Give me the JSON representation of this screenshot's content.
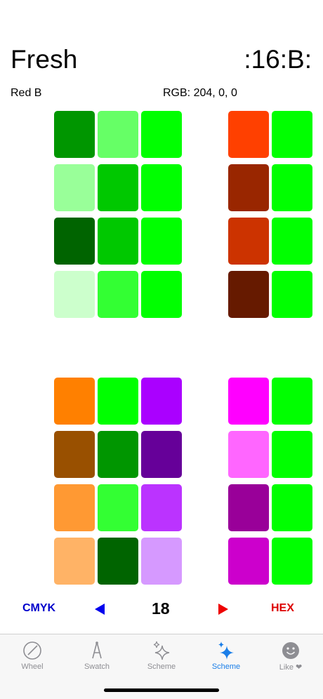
{
  "header": {
    "title": "Fresh",
    "code": ":16:B:"
  },
  "info": {
    "color_name": "Red B",
    "rgb": "RGB: 204, 0, 0"
  },
  "grids": {
    "g1": {
      "cols": 3,
      "colors": [
        "#009600",
        "#66ff66",
        "#00ff00",
        "#99ff99",
        "#00c800",
        "#00ff00",
        "#006400",
        "#00c800",
        "#00ff00",
        "#ccffcc",
        "#33ff33",
        "#00ff00"
      ]
    },
    "g2": {
      "cols": 2,
      "colors": [
        "#ff4000",
        "#00ff00",
        "#992600",
        "#00ff00",
        "#cc3300",
        "#00ff00",
        "#661a00",
        "#00ff00"
      ]
    },
    "g3": {
      "cols": 3,
      "colors": [
        "#ff8000",
        "#00ff00",
        "#aa00ff",
        "#995000",
        "#009600",
        "#660099",
        "#ff9933",
        "#33ff33",
        "#bb33ff",
        "#ffb366",
        "#006400",
        "#d699ff"
      ]
    },
    "g4": {
      "cols": 2,
      "colors": [
        "#ff00ff",
        "#00ff00",
        "#ff66ff",
        "#00ff00",
        "#990099",
        "#00ff00",
        "#cc00cc",
        "#00ff00"
      ]
    }
  },
  "controls": {
    "cmyk": "CMYK",
    "page": "18",
    "hex": "HEX",
    "prev_icon": "left-triangle-icon",
    "next_icon": "right-triangle-icon",
    "prev_color": "#0000ee",
    "next_color": "#ee0000"
  },
  "tabs": [
    {
      "label": "Wheel",
      "icon": "wheel-icon",
      "active": false
    },
    {
      "label": "Swatch",
      "icon": "swatch-icon",
      "active": false
    },
    {
      "label": "Scheme",
      "icon": "sparkle-icon",
      "active": false
    },
    {
      "label": "Scheme",
      "icon": "sparkle-icon",
      "active": true
    },
    {
      "label": "Like ❤",
      "icon": "smiley-icon",
      "active": false
    }
  ],
  "accent": "#1a7ee8"
}
